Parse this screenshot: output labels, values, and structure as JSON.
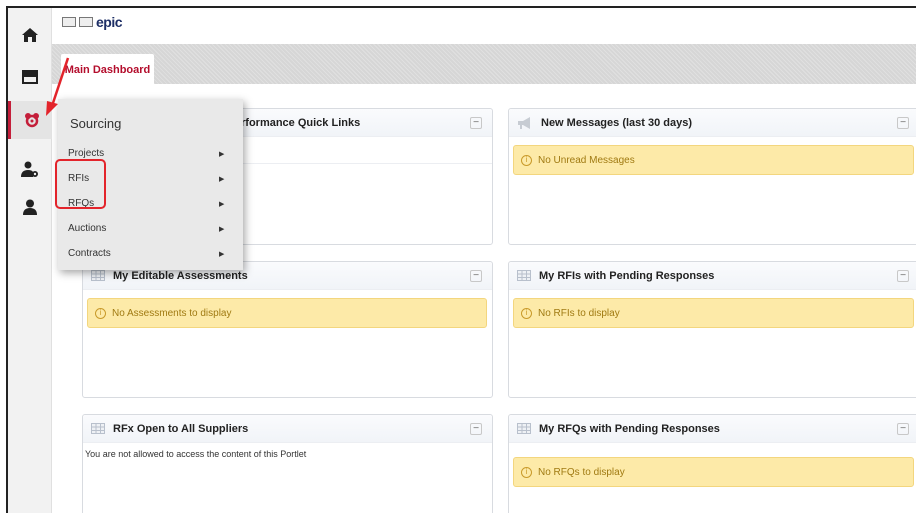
{
  "colors": {
    "accent": "#c41e3a",
    "alert_bg": "#fdeaa8",
    "alert_text": "#a07a12",
    "highlight": "#e3242b"
  },
  "logo": {
    "text": "epic",
    "icon": "logo-emblem"
  },
  "rail": {
    "items": [
      {
        "icon": "home-icon"
      },
      {
        "icon": "dashboard-icon"
      },
      {
        "icon": "sourcing-icon"
      },
      {
        "icon": "user-settings-icon"
      },
      {
        "icon": "user-icon"
      }
    ]
  },
  "tabs": [
    {
      "label": "Main Dashboard"
    }
  ],
  "menu": {
    "title": "Sourcing",
    "items": [
      {
        "label": "Projects"
      },
      {
        "label": "RFIs"
      },
      {
        "label": "RFQs"
      },
      {
        "label": "Auctions"
      },
      {
        "label": "Contracts"
      }
    ]
  },
  "portlets": {
    "performance": {
      "title": "Performance Quick Links",
      "visible_title": "rformance Quick Links"
    },
    "messages": {
      "title": "New Messages (last 30 days)",
      "alert": "No Unread Messages"
    },
    "assessments": {
      "title": "My Editable Assessments",
      "alert": "No Assessments to display"
    },
    "rfis": {
      "title": "My RFIs with Pending Responses",
      "alert": "No RFIs to display"
    },
    "rfx": {
      "title": "RFx Open to All Suppliers",
      "message": "You are not allowed to access the content of this Portlet"
    },
    "rfqs": {
      "title": "My RFQs with Pending Responses",
      "alert": "No RFQs to display"
    }
  },
  "minimize_symbol": "−",
  "info_symbol": "i"
}
